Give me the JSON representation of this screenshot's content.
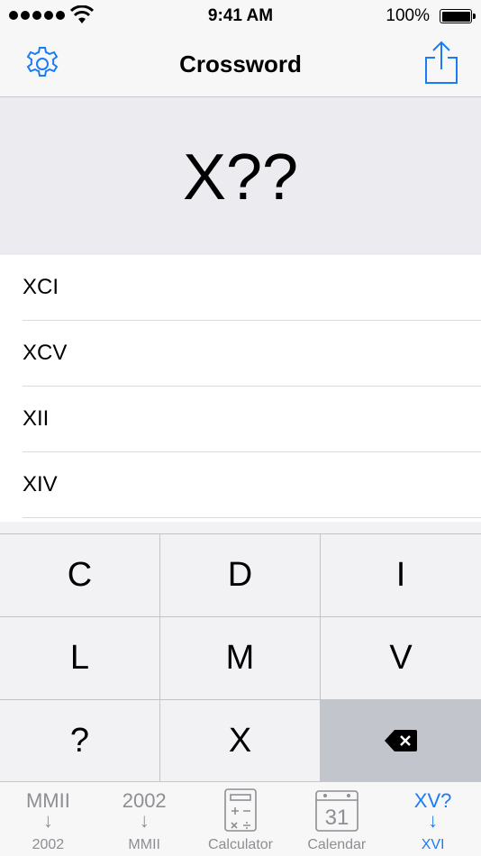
{
  "status_bar": {
    "time": "9:41 AM",
    "battery_percent": "100%"
  },
  "nav": {
    "title": "Crossword",
    "left_icon": "gear-icon",
    "right_icon": "share-icon"
  },
  "display": {
    "query": "X??"
  },
  "results": [
    "XCI",
    "XCV",
    "XII",
    "XIV"
  ],
  "keypad": {
    "keys": [
      "C",
      "D",
      "I",
      "L",
      "M",
      "V",
      "?",
      "X"
    ],
    "delete_icon": "backspace-icon"
  },
  "tabs": [
    {
      "top": "MMII",
      "arrow": "↓",
      "label": "2002",
      "active": false
    },
    {
      "top": "2002",
      "arrow": "↓",
      "label": "MMII",
      "active": false
    },
    {
      "icon": "calculator-icon",
      "label": "Calculator",
      "active": false
    },
    {
      "icon": "calendar-icon",
      "icon_text": "31",
      "label": "Calendar",
      "active": false
    },
    {
      "top": "XV?",
      "arrow": "↓",
      "label": "XVI",
      "active": true
    }
  ],
  "colors": {
    "accent": "#1a7cf5",
    "inactive": "#8e8e93",
    "display_bg": "#ebebf0",
    "delete_key": "#c3c5cc"
  }
}
